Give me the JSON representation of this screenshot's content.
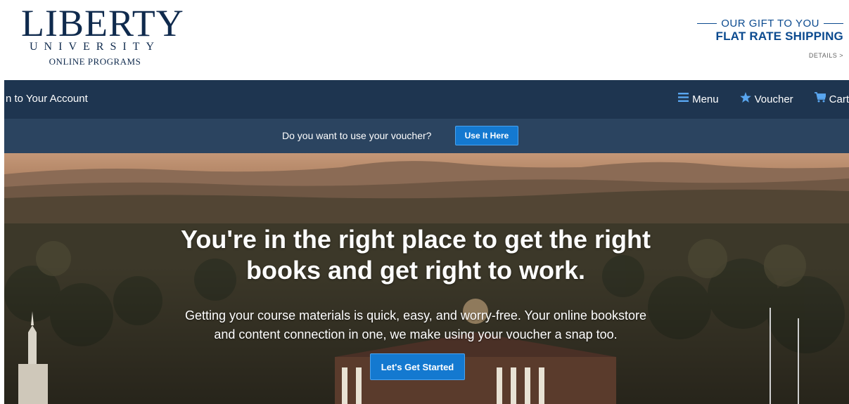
{
  "logo": {
    "line1": "LIBERTY",
    "line2": "UNIVERSITY",
    "line3": "ONLINE PROGRAMS"
  },
  "promo": {
    "tagline": "OUR GIFT TO YOU",
    "headline": "FLAT RATE SHIPPING",
    "details_link": "DETAILS >"
  },
  "nav": {
    "account_label": "n to Your Account",
    "menu_label": "Menu",
    "voucher_label": "Voucher",
    "cart_label": "Cart",
    "icons": {
      "menu": "menu-icon",
      "voucher": "star-icon",
      "cart": "cart-icon"
    }
  },
  "voucher_bar": {
    "question": "Do you want to use your voucher?",
    "button_label": "Use It Here"
  },
  "hero": {
    "title_line1": "You're in the right place to get the right",
    "title_line2": "books and get right to work.",
    "subtitle_line1": "Getting your course materials is quick, easy, and worry-free. Your online bookstore",
    "subtitle_line2": "and content connection in one, we make using your voucher a snap too.",
    "cta_label": "Let's Get Started"
  },
  "colors": {
    "navy": "#1e3550",
    "voucher_bar": "#2b4460",
    "accent_blue": "#1479d0",
    "promo_blue": "#0b4a8f"
  }
}
